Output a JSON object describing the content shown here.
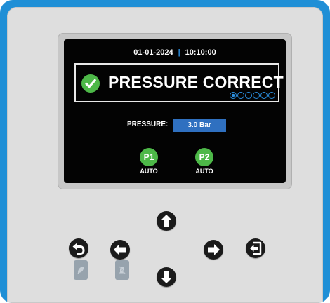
{
  "screen": {
    "date": "01-01-2024",
    "time": "10:10:00",
    "status": {
      "text": "PRESSURE CORRECT",
      "icon": "check-circle-icon",
      "page_count": 6,
      "active_page": 1
    },
    "pressure": {
      "label": "PRESSURE:",
      "value": "3.0 Bar"
    },
    "pumps": [
      {
        "label": "P1",
        "mode": "AUTO"
      },
      {
        "label": "P2",
        "mode": "AUTO"
      }
    ]
  },
  "keys": {
    "up": "arrow-up-icon",
    "down": "arrow-down-icon",
    "left": "arrow-left-icon",
    "right": "arrow-right-icon",
    "back": "back-icon",
    "enter": "exit-icon"
  },
  "colors": {
    "frame": "#1f8fd6",
    "panel": "#dedede",
    "screen": "#030303",
    "ok_green": "#4db848",
    "accent_blue": "#2f70c0",
    "dot_blue": "#2b8fe0"
  }
}
